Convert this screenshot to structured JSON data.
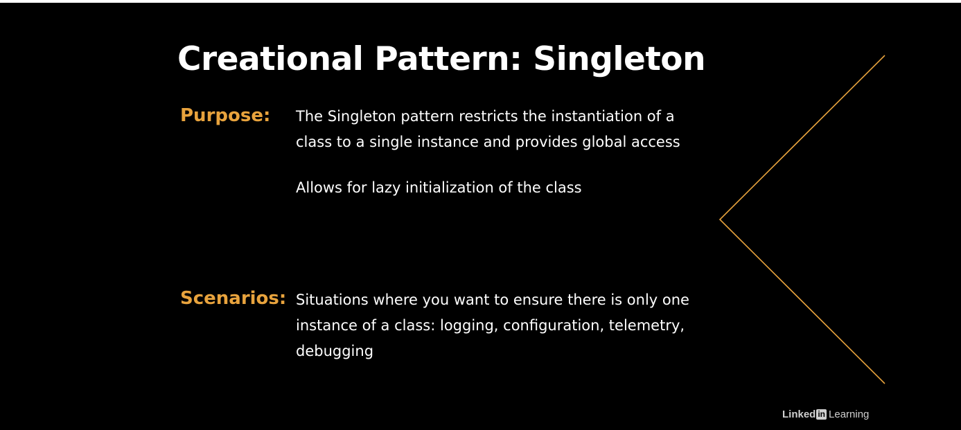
{
  "slide": {
    "title": "Creational Pattern: Singleton",
    "purpose_label": "Purpose:",
    "purpose_lines": [
      "The Singleton pattern restricts the instantiation of a class to a single instance and provides global access",
      "Allows for lazy initialization of the class"
    ],
    "scenarios_label": "Scenarios:",
    "scenarios_text": "Situations where you want to ensure there is only one instance of a class: logging, configuration, telemetry, debugging"
  },
  "logo": {
    "linked": "Linked",
    "in": "in",
    "learning": "Learning"
  },
  "colors": {
    "background": "#000000",
    "accent": "#e8a33d",
    "text": "#ffffff",
    "logo": "#cfcfcf"
  },
  "icons": {
    "chevron": "left-chevron-line-icon"
  }
}
